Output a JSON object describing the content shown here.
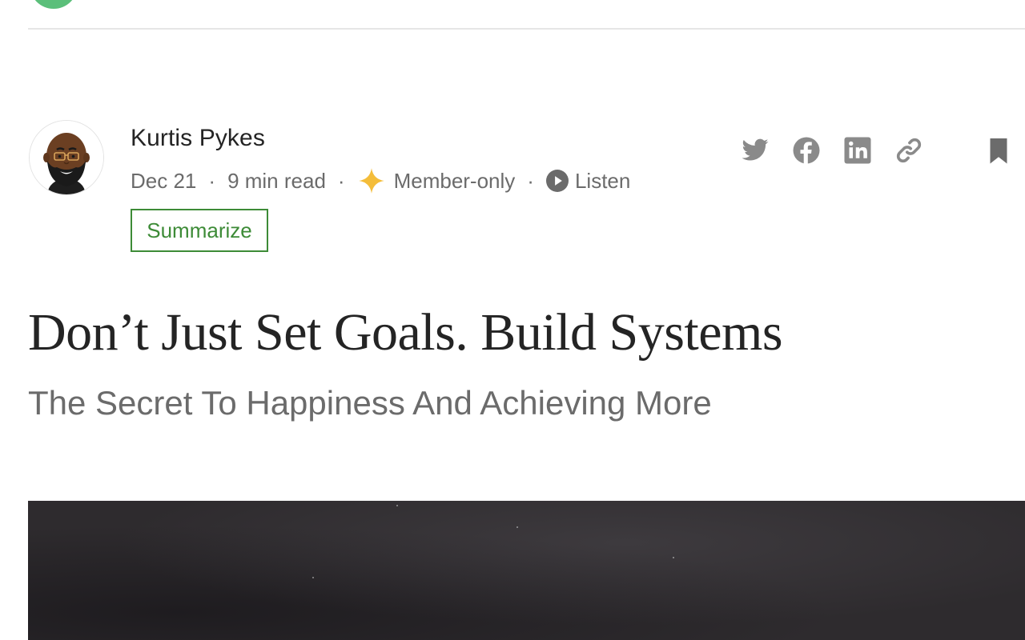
{
  "author": {
    "name": "Kurtis Pykes"
  },
  "meta": {
    "date": "Dec 21",
    "read_time": "9 min read",
    "membership": "Member-only",
    "listen_label": "Listen",
    "separator": "·"
  },
  "actions": {
    "summarize_label": "Summarize"
  },
  "share_icons": [
    "twitter-icon",
    "facebook-icon",
    "linkedin-icon",
    "link-icon",
    "bookmark-icon"
  ],
  "article": {
    "title": "Don’t Just Set Goals. Build Systems",
    "subtitle": "The Secret To Happiness And Achieving More"
  },
  "colors": {
    "accent_green": "#3d8b37",
    "member_star": "#f4bd3a",
    "text_primary": "#242424",
    "text_secondary": "#6b6b6b",
    "icon_gray": "#8a8a8a"
  }
}
